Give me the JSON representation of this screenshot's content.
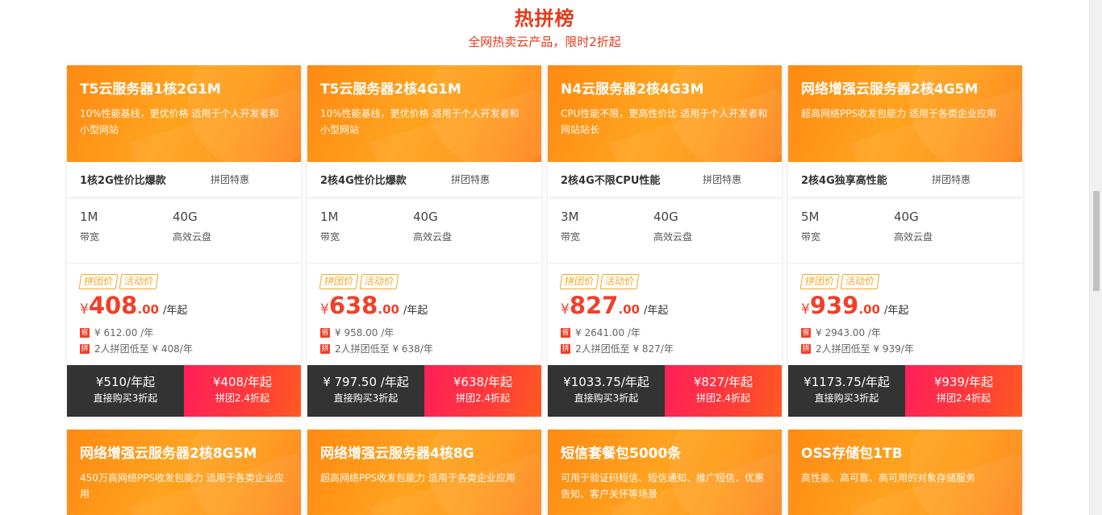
{
  "section": {
    "title": "热拼榜",
    "subtitle": "全网热卖云产品，限时2折起"
  },
  "colors": {
    "accent": "#e8391a",
    "card_head": "#ff9414",
    "price": "#f0402a",
    "buy_button": "#333333",
    "group_button": "#ff2a50"
  },
  "labels": {
    "badge_group": "拼团价",
    "badge_event": "活动价",
    "save_icon": "省",
    "pin_icon": "拼",
    "bandwidth": "带宽",
    "disk": "高效云盘",
    "per_year_from": "/年起",
    "currency": "¥",
    "buy_sub": "直接购买3折起",
    "group_sub": "拼团2.4折起"
  },
  "cards": [
    {
      "title": "T5云服务器1核2G1M",
      "desc": "10%性能基线，更优价格 适用于个人开发者和小型网站",
      "feature": "1核2G性价比爆款",
      "promo": "拼团特惠",
      "bandwidth": "1M",
      "disk": "40G",
      "price_int": "408",
      "price_dec": ".00",
      "original": "¥ 612.00 /年",
      "group_note": "2人拼团低至 ¥ 408/年",
      "buy_price": "¥510/年起",
      "group_price": "¥408/年起"
    },
    {
      "title": "T5云服务器2核4G1M",
      "desc": "10%性能基线，更优价格 适用于个人开发者和小型网站",
      "feature": "2核4G性价比爆款",
      "promo": "拼团特惠",
      "bandwidth": "1M",
      "disk": "40G",
      "price_int": "638",
      "price_dec": ".00",
      "original": "¥ 958.00 /年",
      "group_note": "2人拼团低至 ¥ 638/年",
      "buy_price": "¥  797.50 /年起",
      "group_price": "¥638/年起"
    },
    {
      "title": "N4云服务器2核4G3M",
      "desc": "CPU性能不限，更高性价比 适用于个人开发者和网站站长",
      "feature": "2核4G不限CPU性能",
      "promo": "拼团特惠",
      "bandwidth": "3M",
      "disk": "40G",
      "price_int": "827",
      "price_dec": ".00",
      "original": "¥ 2641.00 /年",
      "group_note": "2人拼团低至 ¥ 827/年",
      "buy_price": "¥1033.75/年起",
      "group_price": "¥827/年起"
    },
    {
      "title": "网络增强云服务器2核4G5M",
      "desc": "超高网络PPS收发包能力 适用于各类企业应用",
      "feature": "2核4G独享高性能",
      "promo": "拼团特惠",
      "bandwidth": "5M",
      "disk": "40G",
      "price_int": "939",
      "price_dec": ".00",
      "original": "¥ 2943.00 /年",
      "group_note": "2人拼团低至 ¥ 939/年",
      "buy_price": "¥1173.75/年起",
      "group_price": "¥939/年起"
    }
  ],
  "cards_row2": [
    {
      "title": "网络增强云服务器2核8G5M",
      "desc": "450万高网络PPS收发包能力 适用于各类企业应用"
    },
    {
      "title": "网络增强云服务器4核8G",
      "desc": "超高网络PPS收发包能力 适用于各类企业应用"
    },
    {
      "title": "短信套餐包5000条",
      "desc": "可用于验证码短信、短信通知、推广短信、优惠告知、客户关怀等场景"
    },
    {
      "title": "OSS存储包1TB",
      "desc": "高性能、高可靠、高可用的对象存储服务"
    }
  ]
}
